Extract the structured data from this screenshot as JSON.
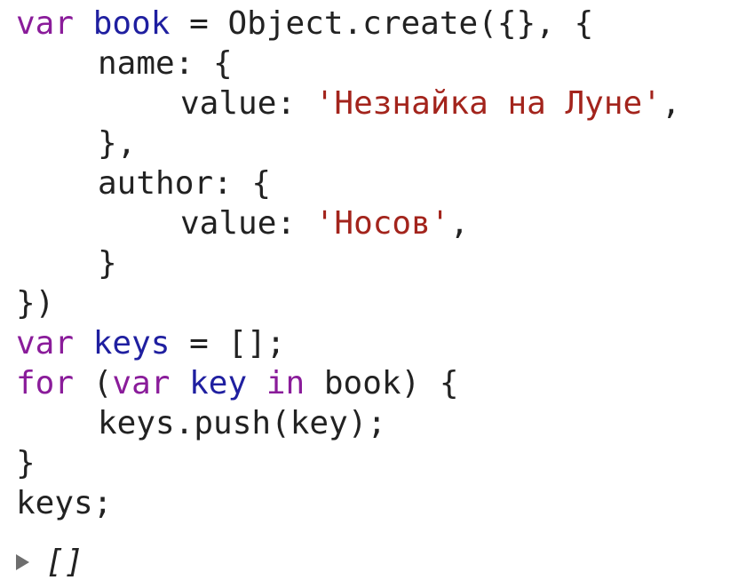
{
  "code": {
    "l1_var": "var",
    "l1_name": "book",
    "l1_rest": " = Object.create({}, {",
    "l2": "name: {",
    "l3_prop": "value: ",
    "l3_str": "'Незнайка на Луне'",
    "l3_end": ",",
    "l4": "},",
    "l5": "author: {",
    "l6_prop": "value: ",
    "l6_str": "'Носов'",
    "l6_end": ",",
    "l7": "}",
    "l8": "})",
    "l9_var": "var",
    "l9_name": "keys",
    "l9_rest": " = [];",
    "l10_for": "for",
    "l10_open": " (",
    "l10_var": "var",
    "l10_key": "key",
    "l10_in": "in",
    "l10_rest": " book) {",
    "l11": "keys.push(key);",
    "l12": "}",
    "l13": "keys;"
  },
  "result": {
    "value": "[]"
  }
}
